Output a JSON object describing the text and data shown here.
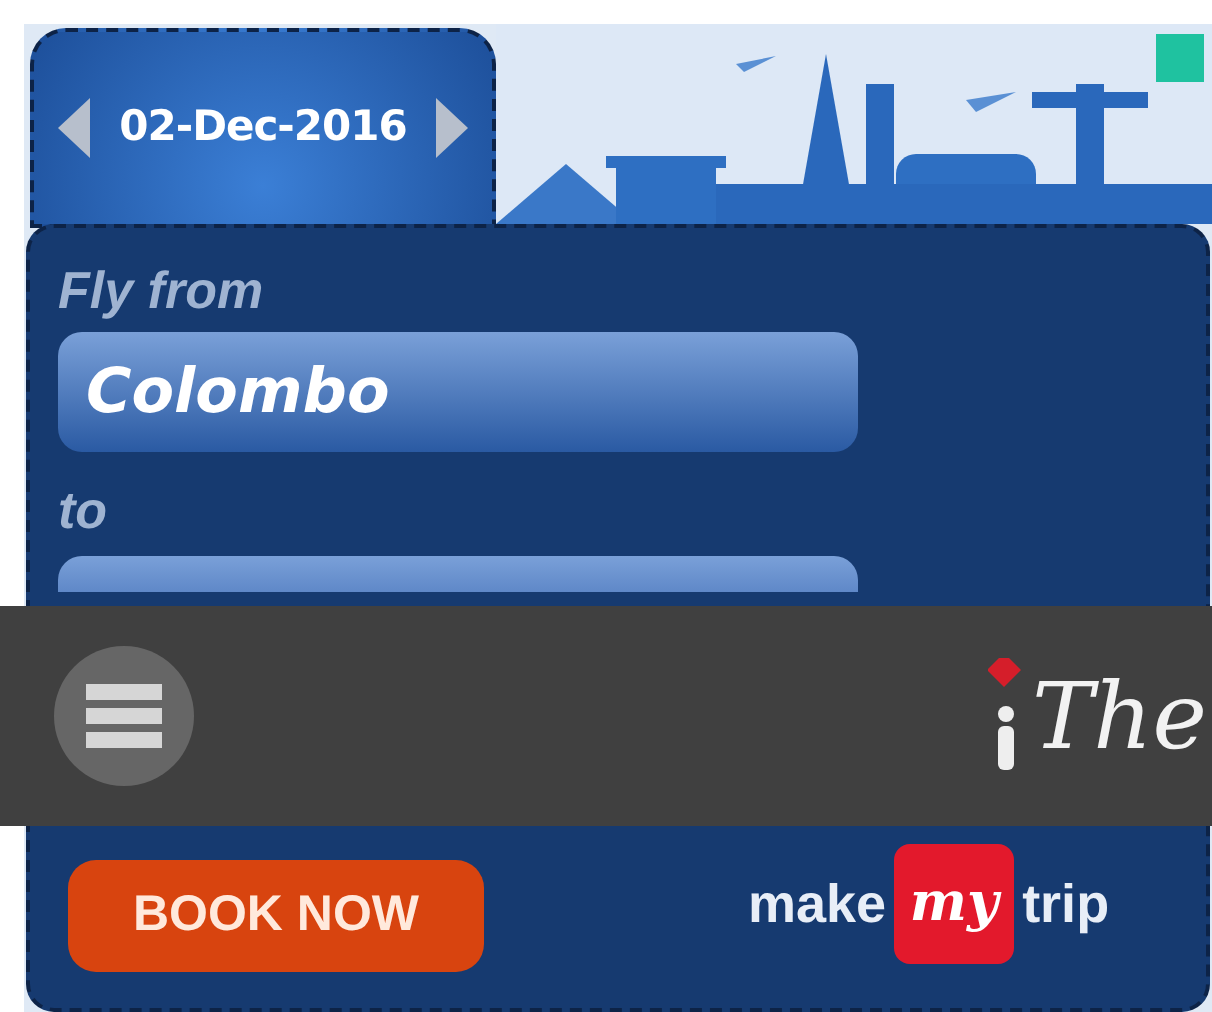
{
  "ad": {
    "date": "02-Dec-2016",
    "from_label": "Fly from",
    "from_value": "Colombo",
    "to_label": "to",
    "book_button": "BOOK NOW",
    "brand": {
      "left": "make",
      "middle": "my",
      "right": "trip"
    }
  },
  "header": {
    "logo_text": "The"
  }
}
